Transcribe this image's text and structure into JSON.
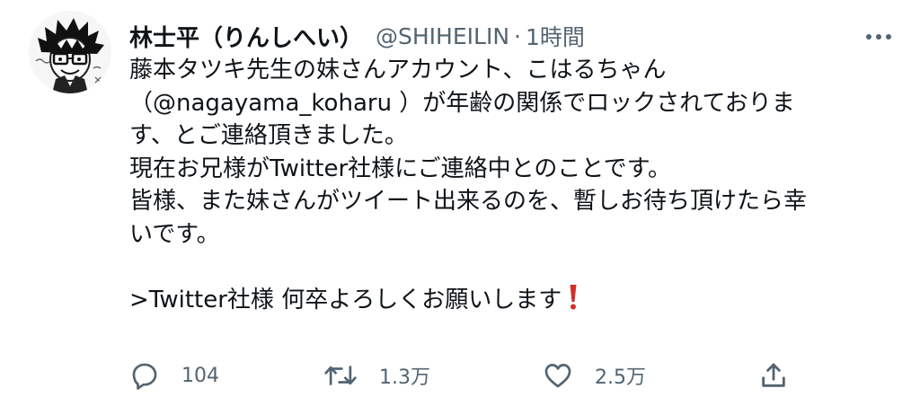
{
  "tweet": {
    "author": {
      "display_name": "林士平（りんしへい）",
      "handle": "@SHIHEILIN",
      "separator": "·",
      "time": "1時間"
    },
    "body": [
      "藤本タツキ先生の妹さんアカウント、こはるちゃん",
      "（@nagayama_koharu ）が年齢の関係でロックされておりま",
      "す、とご連絡頂きました。",
      "現在お兄様がTwitter社様にご連絡中とのことです。",
      "皆様、また妹さんがツイート出来るのを、暫しお待ち頂けたら幸",
      "いです。",
      "",
      ">Twitter社様 何卒よろしくお願いします"
    ],
    "actions": {
      "reply_count": "104",
      "retweet_count": "1.3万",
      "like_count": "2.5万"
    },
    "icons": {
      "more": "more-icon",
      "reply": "reply-icon",
      "retweet": "retweet-icon",
      "like": "heart-icon",
      "share": "share-icon",
      "exclamation": "red-exclamation-icon"
    },
    "colors": {
      "text": "#0f1419",
      "secondary": "#536471",
      "exclamation": "#d0312d"
    }
  }
}
